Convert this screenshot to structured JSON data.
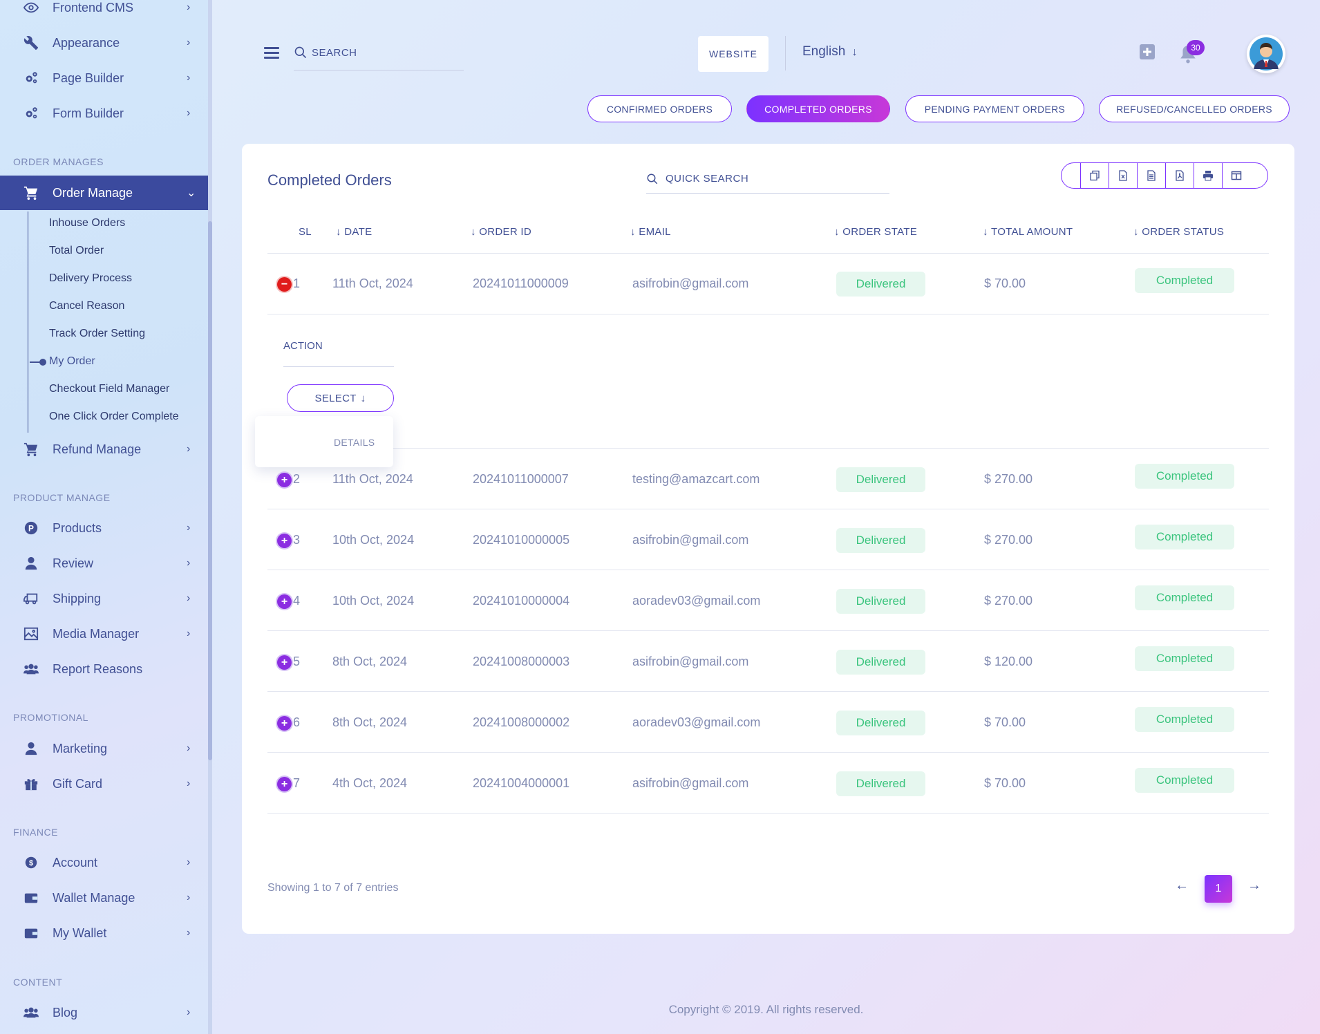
{
  "sidebar": {
    "top_items": [
      {
        "label": "Frontend CMS",
        "icon": "eye-icon"
      },
      {
        "label": "Appearance",
        "icon": "wrench-icon"
      },
      {
        "label": "Page Builder",
        "icon": "cogs-icon"
      },
      {
        "label": "Form Builder",
        "icon": "cogs-icon"
      }
    ],
    "sections": {
      "order": "ORDER MANAGES",
      "product": "PRODUCT MANAGE",
      "promotional": "PROMOTIONAL",
      "finance": "FINANCE",
      "content": "CONTENT"
    },
    "order_manage": {
      "label": "Order Manage",
      "sub_items": [
        "Inhouse Orders",
        "Total Order",
        "Delivery Process",
        "Cancel Reason",
        "Track Order Setting",
        "My Order",
        "Checkout Field Manager",
        "One Click Order Complete"
      ]
    },
    "refund_manage": "Refund Manage",
    "product_items": [
      "Products",
      "Review",
      "Shipping",
      "Media Manager",
      "Report Reasons"
    ],
    "promotional_items": [
      "Marketing",
      "Gift Card"
    ],
    "finance_items": [
      "Account",
      "Wallet Manage",
      "My Wallet"
    ],
    "content_items": [
      "Blog"
    ]
  },
  "header": {
    "search_placeholder": "SEARCH",
    "website_label": "WEBSITE",
    "language": "English",
    "notification_count": "30"
  },
  "tabs": [
    {
      "label": "CONFIRMED ORDERS",
      "active": false
    },
    {
      "label": "COMPLETED ORDERS",
      "active": true
    },
    {
      "label": "PENDING PAYMENT ORDERS",
      "active": false
    },
    {
      "label": "REFUSED/CANCELLED ORDERS",
      "active": false
    }
  ],
  "card": {
    "title": "Completed Orders",
    "quick_search_placeholder": "QUICK SEARCH",
    "columns": [
      "SL",
      "DATE",
      "ORDER ID",
      "EMAIL",
      "ORDER STATE",
      "TOTAL AMOUNT",
      "ORDER STATUS"
    ],
    "rows": [
      {
        "sl": "1",
        "date": "11th Oct, 2024",
        "order_id": "20241011000009",
        "email": "asifrobin@gmail.com",
        "state": "Delivered",
        "amount": "$ 70.00",
        "status": "Completed",
        "expanded": true
      },
      {
        "sl": "2",
        "date": "11th Oct, 2024",
        "order_id": "20241011000007",
        "email": "testing@amazcart.com",
        "state": "Delivered",
        "amount": "$ 270.00",
        "status": "Completed",
        "expanded": false
      },
      {
        "sl": "3",
        "date": "10th Oct, 2024",
        "order_id": "20241010000005",
        "email": "asifrobin@gmail.com",
        "state": "Delivered",
        "amount": "$ 270.00",
        "status": "Completed",
        "expanded": false
      },
      {
        "sl": "4",
        "date": "10th Oct, 2024",
        "order_id": "20241010000004",
        "email": "aoradev03@gmail.com",
        "state": "Delivered",
        "amount": "$ 270.00",
        "status": "Completed",
        "expanded": false
      },
      {
        "sl": "5",
        "date": "8th Oct, 2024",
        "order_id": "20241008000003",
        "email": "asifrobin@gmail.com",
        "state": "Delivered",
        "amount": "$ 120.00",
        "status": "Completed",
        "expanded": false
      },
      {
        "sl": "6",
        "date": "8th Oct, 2024",
        "order_id": "20241008000002",
        "email": "aoradev03@gmail.com",
        "state": "Delivered",
        "amount": "$ 70.00",
        "status": "Completed",
        "expanded": false
      },
      {
        "sl": "7",
        "date": "4th Oct, 2024",
        "order_id": "20241004000001",
        "email": "asifrobin@gmail.com",
        "state": "Delivered",
        "amount": "$ 70.00",
        "status": "Completed",
        "expanded": false
      }
    ],
    "action_label": "ACTION",
    "select_label": "SELECT",
    "dropdown_item": "DETAILS",
    "showing": "Showing 1 to 7 of 7 entries",
    "current_page": "1"
  },
  "footer": "Copyright © 2019. All rights reserved.",
  "colors": {
    "primary": "#415094",
    "accent": "#7c32ff",
    "accent_end": "#c738d8",
    "success": "#3ac47d",
    "success_bg": "#e6f7ef",
    "danger": "#e01c1c"
  }
}
